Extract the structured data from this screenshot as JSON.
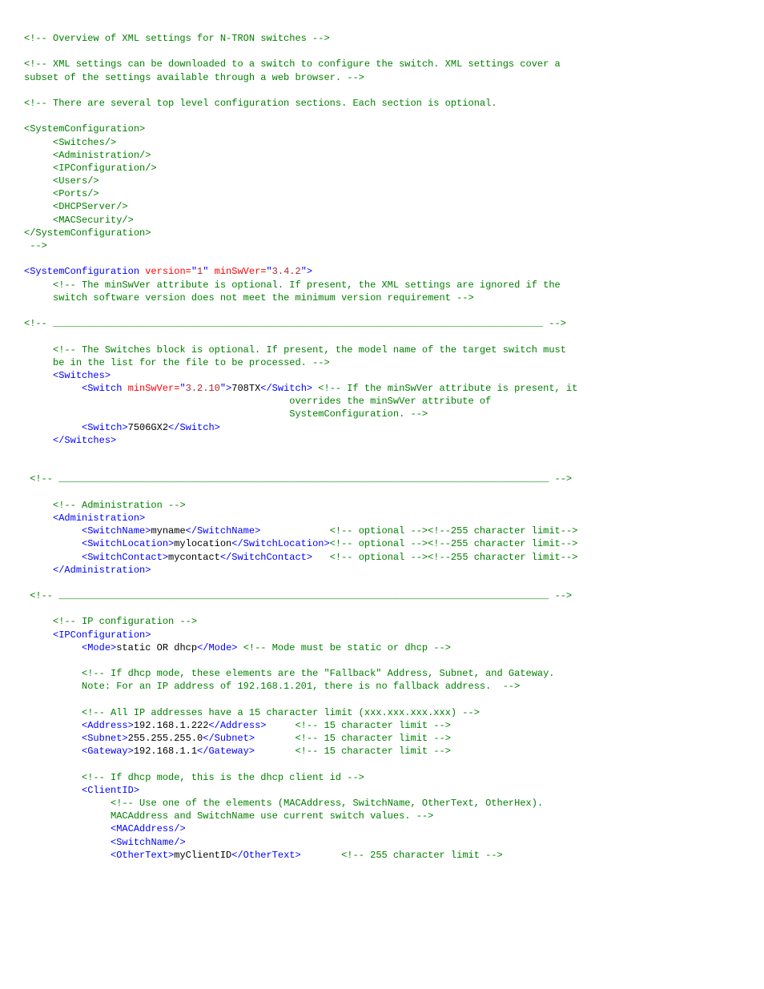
{
  "lines": [
    [
      [
        "c",
        "<!-- Overview of XML settings for N-TRON switches -->"
      ]
    ],
    [
      [
        "x",
        ""
      ]
    ],
    [
      [
        "c",
        "<!-- XML settings can be downloaded to a switch to configure the switch. XML settings cover a"
      ]
    ],
    [
      [
        "c",
        "subset of the settings available through a web browser. -->"
      ]
    ],
    [
      [
        "x",
        ""
      ]
    ],
    [
      [
        "c",
        "<!-- There are several top level configuration sections. Each section is optional."
      ]
    ],
    [
      [
        "x",
        ""
      ]
    ],
    [
      [
        "c",
        "<SystemConfiguration>"
      ]
    ],
    [
      [
        "c",
        "     <Switches/>"
      ]
    ],
    [
      [
        "c",
        "     <Administration/>"
      ]
    ],
    [
      [
        "c",
        "     <IPConfiguration/>"
      ]
    ],
    [
      [
        "c",
        "     <Users/>"
      ]
    ],
    [
      [
        "c",
        "     <Ports/>"
      ]
    ],
    [
      [
        "c",
        "     <DHCPServer/>"
      ]
    ],
    [
      [
        "c",
        "     <MACSecurity/>"
      ]
    ],
    [
      [
        "c",
        "</SystemConfiguration>"
      ]
    ],
    [
      [
        "c",
        " -->"
      ]
    ],
    [
      [
        "x",
        ""
      ]
    ],
    [
      [
        "t",
        "<SystemConfiguration "
      ],
      [
        "a",
        "version="
      ],
      [
        "t",
        "\""
      ],
      [
        "v",
        "1"
      ],
      [
        "t",
        "\" "
      ],
      [
        "a",
        "minSwVer="
      ],
      [
        "t",
        "\""
      ],
      [
        "v",
        "3.4.2"
      ],
      [
        "t",
        "\">"
      ]
    ],
    [
      [
        "x",
        "     "
      ],
      [
        "c",
        "<!-- The minSwVer attribute is optional. If present, the XML settings are ignored if the"
      ]
    ],
    [
      [
        "x",
        "     "
      ],
      [
        "c",
        "switch software version does not meet the minimum version requirement -->"
      ]
    ],
    [
      [
        "x",
        ""
      ]
    ],
    [
      [
        "c",
        "<!-- _____________________________________________________________________________________ -->"
      ]
    ],
    [
      [
        "x",
        ""
      ]
    ],
    [
      [
        "x",
        "     "
      ],
      [
        "c",
        "<!-- The Switches block is optional. If present, the model name of the target switch must"
      ]
    ],
    [
      [
        "x",
        "     "
      ],
      [
        "c",
        "be in the list for the file to be processed. -->"
      ]
    ],
    [
      [
        "x",
        "     "
      ],
      [
        "t",
        "<Switches>"
      ]
    ],
    [
      [
        "x",
        "          "
      ],
      [
        "t",
        "<Switch "
      ],
      [
        "a",
        "minSwVer="
      ],
      [
        "t",
        "\""
      ],
      [
        "v",
        "3.2.10"
      ],
      [
        "t",
        "\">"
      ],
      [
        "x",
        "708TX"
      ],
      [
        "t",
        "</Switch>"
      ],
      [
        "x",
        " "
      ],
      [
        "c",
        "<!-- If the minSwVer attribute is present, it"
      ]
    ],
    [
      [
        "x",
        "                                              "
      ],
      [
        "c",
        "overrides the minSwVer attribute of"
      ]
    ],
    [
      [
        "x",
        "                                              "
      ],
      [
        "c",
        "SystemConfiguration. -->"
      ]
    ],
    [
      [
        "x",
        "          "
      ],
      [
        "t",
        "<Switch>"
      ],
      [
        "x",
        "7506GX2"
      ],
      [
        "t",
        "</Switch>"
      ]
    ],
    [
      [
        "x",
        "     "
      ],
      [
        "t",
        "</Switches>"
      ]
    ],
    [
      [
        "x",
        ""
      ]
    ],
    [
      [
        "x",
        ""
      ]
    ],
    [
      [
        "c",
        " <!-- _____________________________________________________________________________________ -->"
      ]
    ],
    [
      [
        "x",
        ""
      ]
    ],
    [
      [
        "x",
        "     "
      ],
      [
        "c",
        "<!-- Administration -->"
      ]
    ],
    [
      [
        "x",
        "     "
      ],
      [
        "t",
        "<Administration>"
      ]
    ],
    [
      [
        "x",
        "          "
      ],
      [
        "t",
        "<SwitchName>"
      ],
      [
        "x",
        "myname"
      ],
      [
        "t",
        "</SwitchName>"
      ],
      [
        "x",
        "            "
      ],
      [
        "c",
        "<!-- optional --><!--255 character limit-->"
      ]
    ],
    [
      [
        "x",
        "          "
      ],
      [
        "t",
        "<SwitchLocation>"
      ],
      [
        "x",
        "mylocation"
      ],
      [
        "t",
        "</SwitchLocation>"
      ],
      [
        "c",
        "<!-- optional --><!--255 character limit-->"
      ]
    ],
    [
      [
        "x",
        "          "
      ],
      [
        "t",
        "<SwitchContact>"
      ],
      [
        "x",
        "mycontact"
      ],
      [
        "t",
        "</SwitchContact>"
      ],
      [
        "x",
        "   "
      ],
      [
        "c",
        "<!-- optional --><!--255 character limit-->"
      ]
    ],
    [
      [
        "x",
        "     "
      ],
      [
        "t",
        "</Administration>"
      ]
    ],
    [
      [
        "x",
        ""
      ]
    ],
    [
      [
        "c",
        " <!-- _____________________________________________________________________________________ -->"
      ]
    ],
    [
      [
        "x",
        ""
      ]
    ],
    [
      [
        "x",
        "     "
      ],
      [
        "c",
        "<!-- IP configuration -->"
      ]
    ],
    [
      [
        "x",
        "     "
      ],
      [
        "t",
        "<IPConfiguration>"
      ]
    ],
    [
      [
        "x",
        "          "
      ],
      [
        "t",
        "<Mode>"
      ],
      [
        "x",
        "static OR dhcp"
      ],
      [
        "t",
        "</Mode>"
      ],
      [
        "x",
        " "
      ],
      [
        "c",
        "<!-- Mode must be static or dhcp -->"
      ]
    ],
    [
      [
        "x",
        ""
      ]
    ],
    [
      [
        "x",
        "          "
      ],
      [
        "c",
        "<!-- If dhcp mode, these elements are the \"Fallback\" Address, Subnet, and Gateway."
      ]
    ],
    [
      [
        "x",
        "          "
      ],
      [
        "c",
        "Note: For an IP address of 192.168.1.201, there is no fallback address.  -->"
      ]
    ],
    [
      [
        "x",
        ""
      ]
    ],
    [
      [
        "x",
        "          "
      ],
      [
        "c",
        "<!-- All IP addresses have a 15 character limit (xxx.xxx.xxx.xxx) -->"
      ]
    ],
    [
      [
        "x",
        "          "
      ],
      [
        "t",
        "<Address>"
      ],
      [
        "x",
        "192.168.1.222"
      ],
      [
        "t",
        "</Address>"
      ],
      [
        "x",
        "     "
      ],
      [
        "c",
        "<!-- 15 character limit -->"
      ]
    ],
    [
      [
        "x",
        "          "
      ],
      [
        "t",
        "<Subnet>"
      ],
      [
        "x",
        "255.255.255.0"
      ],
      [
        "t",
        "</Subnet>"
      ],
      [
        "x",
        "       "
      ],
      [
        "c",
        "<!-- 15 character limit -->"
      ]
    ],
    [
      [
        "x",
        "          "
      ],
      [
        "t",
        "<Gateway>"
      ],
      [
        "x",
        "192.168.1.1"
      ],
      [
        "t",
        "</Gateway>"
      ],
      [
        "x",
        "       "
      ],
      [
        "c",
        "<!-- 15 character limit -->"
      ]
    ],
    [
      [
        "x",
        ""
      ]
    ],
    [
      [
        "x",
        "          "
      ],
      [
        "c",
        "<!-- If dhcp mode, this is the dhcp client id -->"
      ]
    ],
    [
      [
        "x",
        "          "
      ],
      [
        "t",
        "<ClientID>"
      ]
    ],
    [
      [
        "x",
        "               "
      ],
      [
        "c",
        "<!-- Use one of the elements (MACAddress, SwitchName, OtherText, OtherHex)."
      ]
    ],
    [
      [
        "x",
        "               "
      ],
      [
        "c",
        "MACAddress and SwitchName use current switch values. -->"
      ]
    ],
    [
      [
        "x",
        "               "
      ],
      [
        "t",
        "<MACAddress/>"
      ]
    ],
    [
      [
        "x",
        "               "
      ],
      [
        "t",
        "<SwitchName/>"
      ]
    ],
    [
      [
        "x",
        "               "
      ],
      [
        "t",
        "<OtherText>"
      ],
      [
        "x",
        "myClientID"
      ],
      [
        "t",
        "</OtherText>"
      ],
      [
        "x",
        "       "
      ],
      [
        "c",
        "<!-- 255 character limit -->"
      ]
    ]
  ]
}
